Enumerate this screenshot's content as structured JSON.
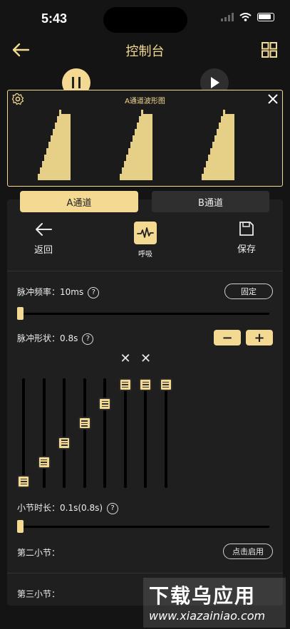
{
  "status": {
    "time": "5:43"
  },
  "header": {
    "title": "控制台"
  },
  "waveform": {
    "title": "A通道波形图"
  },
  "tabs": [
    {
      "label": "A通道",
      "active": true
    },
    {
      "label": "B通道",
      "active": false
    }
  ],
  "actions": {
    "back": "返回",
    "mode": "呼吸",
    "save": "保存"
  },
  "pulse_freq": {
    "label": "脉冲频率：",
    "value": "10ms",
    "fixed_button": "固定",
    "slider_fraction": 0.0
  },
  "pulse_shape": {
    "label": "脉冲形状：",
    "value": "0.8s",
    "minus": "−",
    "plus": "+",
    "bar_levels": [
      0.0,
      0.2,
      0.4,
      0.6,
      0.8,
      1.0,
      1.0,
      1.0
    ]
  },
  "section_duration": {
    "label": "小节时长：",
    "value": "0.1s(0.8s)",
    "slider_fraction": 0.0
  },
  "second_section": {
    "label": "第二小节：",
    "button": "点击启用"
  },
  "third_section": {
    "label": "第三小节："
  },
  "watermark": {
    "text": "下载乌应用",
    "url": "www.xiazainiao.com"
  },
  "colors": {
    "accent": "#f3d992",
    "background": "#141414",
    "panel": "#1f1f1f"
  }
}
